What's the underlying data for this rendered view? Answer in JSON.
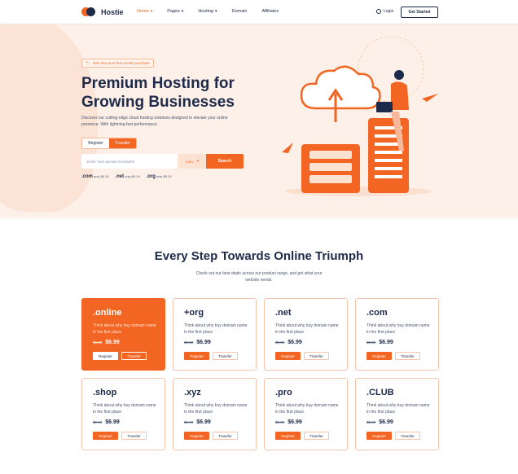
{
  "header": {
    "brand": "Hostie",
    "nav": [
      {
        "label": "Home",
        "active": true,
        "dropdown": true
      },
      {
        "label": "Pages",
        "active": false,
        "dropdown": true
      },
      {
        "label": "Hosting",
        "active": false,
        "dropdown": true
      },
      {
        "label": "Domain",
        "active": false,
        "dropdown": false
      },
      {
        "label": "Affiliates",
        "active": false,
        "dropdown": false
      }
    ],
    "login_label": "Login",
    "cta_label": "Get Started"
  },
  "hero": {
    "badge": "30% Discount first month purchase",
    "title_line1": "Premium Hosting for",
    "title_line2": "Growing Businesses",
    "description": "Discover our cutting-edge cloud hosting solutions designed to elevate your online presence. With lightning-fast performance.",
    "toggle": {
      "register": "Register",
      "transfer": "Transfer",
      "selected": "Transfer"
    },
    "search": {
      "placeholder": "Enter Your domain to transfer",
      "extension": ".com",
      "button": "Search"
    },
    "prices": [
      {
        "tld": ".com",
        "text": "only $6.19"
      },
      {
        "tld": ".net",
        "text": "only $4.19"
      },
      {
        "tld": ".org",
        "text": "only $8.19"
      }
    ]
  },
  "section": {
    "title": "Every Step Towards Online Triumph",
    "subtitle": "Check out our best deals across our product range, and get what your website needs."
  },
  "cards": [
    {
      "tld": ".online",
      "desc": "Think about why buy domain name in the first place",
      "old_price": "$9.99",
      "new_price": "$6.99",
      "register": "Register",
      "transfer": "Transfer",
      "highlight": true
    },
    {
      "tld": "+org",
      "desc": "Think about why buy domain name in the first place",
      "old_price": "$9.99",
      "new_price": "$6.99",
      "register": "Register",
      "transfer": "Transfer",
      "highlight": false
    },
    {
      "tld": ".net",
      "desc": "Think about why buy domain name in the first place",
      "old_price": "$9.99",
      "new_price": "$6.99",
      "register": "Register",
      "transfer": "Transfer",
      "highlight": false
    },
    {
      "tld": ".com",
      "desc": "Think about why buy domain name in the first place",
      "old_price": "$9.99",
      "new_price": "$6.99",
      "register": "Register",
      "transfer": "Transfer",
      "highlight": false
    },
    {
      "tld": ".shop",
      "desc": "Think about why buy domain name in the first place",
      "old_price": "$9.99",
      "new_price": "$6.99",
      "register": "Register",
      "transfer": "Transfer",
      "highlight": false
    },
    {
      "tld": ".xyz",
      "desc": "Think about why buy domain name in the first place",
      "old_price": "$9.99",
      "new_price": "$6.99",
      "register": "Register",
      "transfer": "Transfer",
      "highlight": false
    },
    {
      "tld": ".pro",
      "desc": "Think about why buy domain name in the first place",
      "old_price": "$9.99",
      "new_price": "$6.99",
      "register": "Register",
      "transfer": "Transfer",
      "highlight": false
    },
    {
      "tld": ".CLUB",
      "desc": "Think about why buy domain name in the first place",
      "old_price": "$9.99",
      "new_price": "$6.99",
      "register": "Register",
      "transfer": "Transfer",
      "highlight": false
    }
  ],
  "colors": {
    "accent": "#f26522",
    "navy": "#1e2a4a",
    "hero_bg": "#fdf0e8"
  }
}
